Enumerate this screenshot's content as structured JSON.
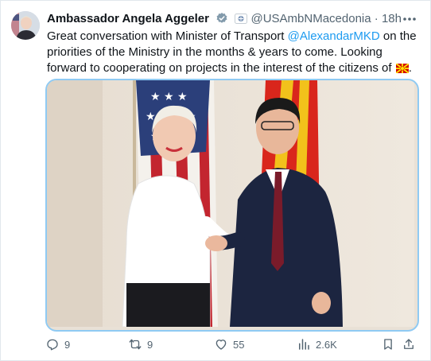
{
  "tweet": {
    "author_name": "Ambassador Angela Aggeler",
    "handle": "@USAmbNMacedonia",
    "separator": "·",
    "time": "18h",
    "text_before": "Great conversation with Minister of Transport ",
    "mention": "@AlexandarMKD",
    "text_after": " on the priorities of the Ministry in the months & years to come. Looking forward to cooperating on projects in the interest of the citizens of ",
    "text_end": ".",
    "flag_emoji_name": "north-macedonia-flag"
  },
  "actions": {
    "replies": "9",
    "retweets": "9",
    "likes": "55",
    "views": "2.6K"
  },
  "colors": {
    "link": "#1d9bf0",
    "muted": "#536471",
    "media_border": "#8fcaf3"
  }
}
